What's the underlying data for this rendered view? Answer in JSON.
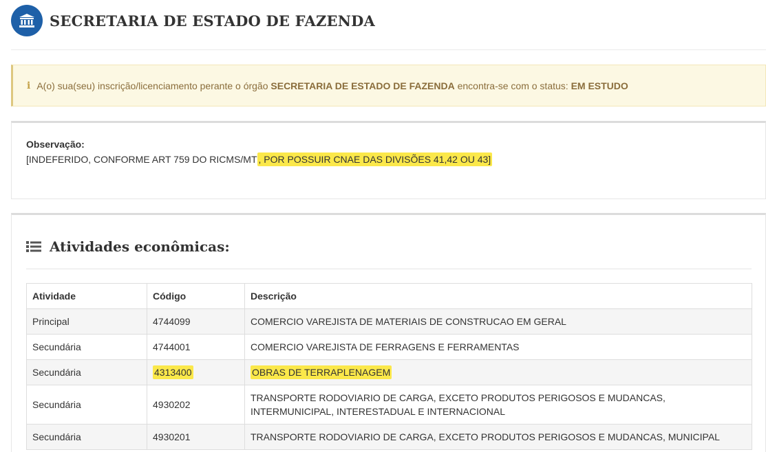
{
  "header": {
    "org_title": "SECRETARIA DE ESTADO DE FAZENDA",
    "icon": "institution-icon",
    "icon_color": "#1e60a8"
  },
  "alert": {
    "icon": "info-icon",
    "text_before": "A(o) sua(seu) inscrição/licenciamento perante o órgão ",
    "org_name": "SECRETARIA DE ESTADO DE FAZENDA",
    "text_middle": " encontra-se com o status: ",
    "status": "EM ESTUDO",
    "bg_color": "#fcf8e3"
  },
  "observation": {
    "label": "Observação:",
    "text_plain": "[INDEFERIDO, CONFORME ART 759 DO RICMS/MT",
    "text_highlighted": ", POR POSSUIR CNAE DAS DIVISÕES 41,42 OU 43]",
    "highlight_color": "#fbe84a"
  },
  "activities": {
    "icon": "list-icon",
    "title": "Atividades econômicas:",
    "columns": [
      "Atividade",
      "Código",
      "Descrição"
    ],
    "rows": [
      {
        "atividade": "Principal",
        "codigo": "4744099",
        "descricao": "COMERCIO VAREJISTA DE MATERIAIS DE CONSTRUCAO EM GERAL"
      },
      {
        "atividade": "Secundária",
        "codigo": "4744001",
        "descricao": "COMERCIO VAREJISTA DE FERRAGENS E FERRAMENTAS"
      },
      {
        "atividade": "Secundária",
        "codigo": "4313400",
        "descricao": "OBRAS DE TERRAPLENAGEM"
      },
      {
        "atividade": "Secundária",
        "codigo": "4930202",
        "descricao": "TRANSPORTE RODOVIARIO DE CARGA, EXCETO PRODUTOS PERIGOSOS E MUDANCAS, INTERMUNICIPAL, INTERESTADUAL E INTERNACIONAL"
      },
      {
        "atividade": "Secundária",
        "codigo": "4930201",
        "descricao": "TRANSPORTE RODOVIARIO DE CARGA, EXCETO PRODUTOS PERIGOSOS E MUDANCAS, MUNICIPAL"
      }
    ]
  }
}
